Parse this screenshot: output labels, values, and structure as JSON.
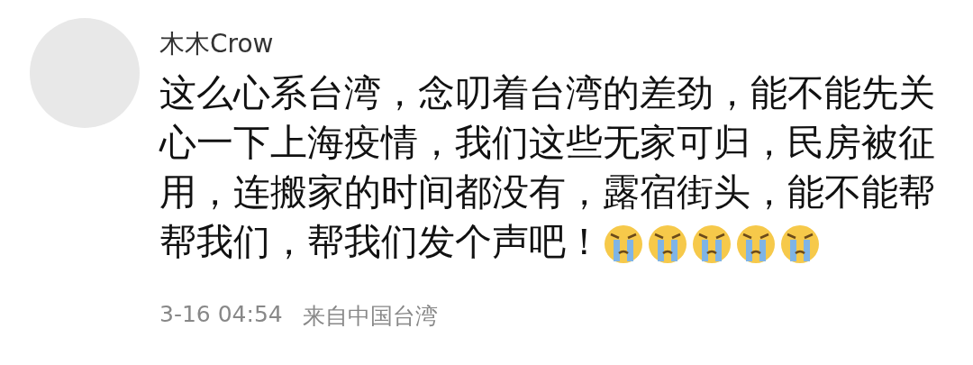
{
  "author": {
    "name": "木木Crow"
  },
  "comment": {
    "text": "这么心系台湾，念叨着台湾的差劲，能不能先关心一下上海疫情，我们这些无家可归，民房被征用，连搬家的时间都没有，露宿街头，能不能帮帮我们，帮我们发个声吧！",
    "emojis": [
      {
        "kind": "crying"
      },
      {
        "kind": "crying"
      },
      {
        "kind": "crying"
      },
      {
        "kind": "crying"
      },
      {
        "kind": "crying"
      }
    ]
  },
  "meta": {
    "time": "3-16 04:54",
    "location": "来自中国台湾"
  }
}
